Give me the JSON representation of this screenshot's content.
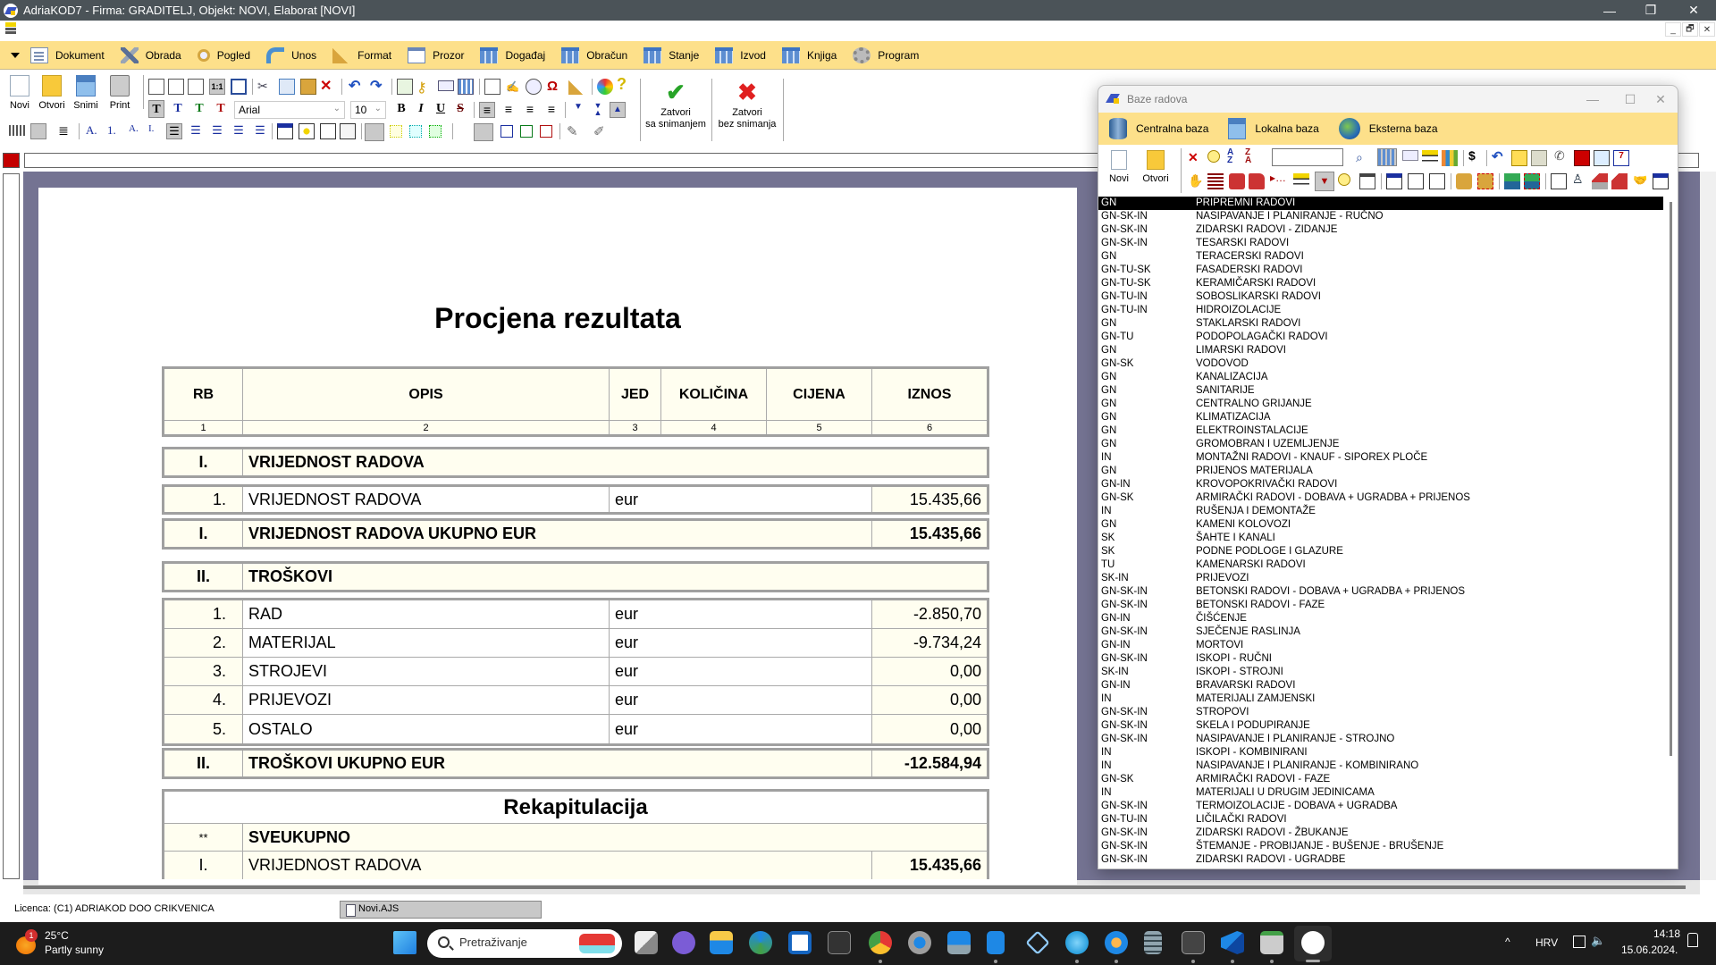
{
  "window": {
    "title": "AdriaKOD7 - Firma: GRADITELJ,   Objekt: NOVI,  Elaborat [NOVI]",
    "minimize": "—",
    "restore": "❐",
    "close": "✕",
    "mdi_minimize": "_",
    "mdi_restore": "🗗",
    "mdi_close": "✕"
  },
  "menubar": {
    "items": [
      {
        "label": "Dokument",
        "icon": "document-icon"
      },
      {
        "label": "Obrada",
        "icon": "tools-icon"
      },
      {
        "label": "Pogled",
        "icon": "magnifier-icon"
      },
      {
        "label": "Unos",
        "icon": "input-icon"
      },
      {
        "label": "Format",
        "icon": "brush-icon"
      },
      {
        "label": "Prozor",
        "icon": "window-icon"
      },
      {
        "label": "Događaj",
        "icon": "grid-icon"
      },
      {
        "label": "Obračun",
        "icon": "grid-icon"
      },
      {
        "label": "Stanje",
        "icon": "grid-icon"
      },
      {
        "label": "Izvod",
        "icon": "grid-icon"
      },
      {
        "label": "Knjiga",
        "icon": "grid-icon"
      },
      {
        "label": "Program",
        "icon": "gear-icon"
      }
    ]
  },
  "toolbar": {
    "new_label": "Novi",
    "open_label": "Otvori",
    "save_label": "Snimi",
    "print_label": "Print",
    "font_name": "Arial",
    "font_size": "10",
    "text_style_glyph": "T",
    "bold_glyph": "B",
    "italic_glyph": "I",
    "underline_glyph": "U",
    "strike_glyph": "S",
    "zoom_11": "1:1",
    "close_save_line1": "Zatvori",
    "close_save_line2": "sa snimanjem",
    "close_nosave_line1": "Zatvori",
    "close_nosave_line2": "bez snimanja",
    "check_glyph": "✔",
    "x_glyph": "✖"
  },
  "document": {
    "title": "Procjena rezultata",
    "header": {
      "cols": [
        "RB",
        "OPIS",
        "JED",
        "KOLIČINA",
        "CIJENA",
        "IZNOS"
      ],
      "nums": [
        "1",
        "2",
        "3",
        "4",
        "5",
        "6"
      ]
    },
    "section1": {
      "rb": "I.",
      "title": "VRIJEDNOST RADOVA",
      "items": [
        {
          "rb": "1.",
          "opis": "VRIJEDNOST RADOVA",
          "jed": "eur",
          "iznos": "15.435,66"
        }
      ],
      "total_rb": "I.",
      "total_label": "VRIJEDNOST RADOVA UKUPNO EUR",
      "total_value": "15.435,66"
    },
    "section2": {
      "rb": "II.",
      "title": "TROŠKOVI",
      "items": [
        {
          "rb": "1.",
          "opis": "RAD",
          "jed": "eur",
          "iznos": "-2.850,70"
        },
        {
          "rb": "2.",
          "opis": "MATERIJAL",
          "jed": "eur",
          "iznos": "-9.734,24"
        },
        {
          "rb": "3.",
          "opis": "STROJEVI",
          "jed": "eur",
          "iznos": "0,00"
        },
        {
          "rb": "4.",
          "opis": "PRIJEVOZI",
          "jed": "eur",
          "iznos": "0,00"
        },
        {
          "rb": "5.",
          "opis": "OSTALO",
          "jed": "eur",
          "iznos": "0,00"
        }
      ],
      "total_rb": "II.",
      "total_label": "TROŠKOVI UKUPNO EUR",
      "total_value": "-12.584,94"
    },
    "recap": {
      "title": "Rekapitulacija",
      "sum_rb": "**",
      "sum_label": "SVEUKUPNO",
      "rows": [
        {
          "rb": "I.",
          "opis": "VRIJEDNOST RADOVA",
          "iznos": "15.435,66"
        }
      ]
    }
  },
  "dialog": {
    "title": "Baze radova",
    "minimize": "—",
    "maximize": "☐",
    "close": "✕",
    "tabs": [
      {
        "label": "Centralna baza",
        "icon": "database-icon"
      },
      {
        "label": "Lokalna baza",
        "icon": "floppy-icon"
      },
      {
        "label": "Eksterna baza",
        "icon": "globe-icon"
      }
    ],
    "new_label": "Novi",
    "open_label": "Otvori",
    "search_value": "",
    "selected_index": 0,
    "rows": [
      {
        "code": "GN",
        "name": "PRIPREMNI RADOVI"
      },
      {
        "code": "GN-SK-IN",
        "name": "NASIPAVANJE I PLANIRANJE - RUČNO"
      },
      {
        "code": "GN-SK-IN",
        "name": "ZIDARSKI RADOVI - ZIDANJE"
      },
      {
        "code": "GN-SK-IN",
        "name": "TESARSKI RADOVI"
      },
      {
        "code": "GN",
        "name": "TERACERSKI RADOVI"
      },
      {
        "code": "GN-TU-SK",
        "name": "FASADERSKI RADOVI"
      },
      {
        "code": "GN-TU-SK",
        "name": "KERAMIČARSKI RADOVI"
      },
      {
        "code": "GN-TU-IN",
        "name": "SOBOSLIKARSKI RADOVI"
      },
      {
        "code": "GN-TU-IN",
        "name": "HIDROIZOLACIJE"
      },
      {
        "code": "GN",
        "name": "STAKLARSKI RADOVI"
      },
      {
        "code": "GN-TU",
        "name": "PODOPOLAGAČKI RADOVI"
      },
      {
        "code": "GN",
        "name": "LIMARSKI RADOVI"
      },
      {
        "code": "GN-SK",
        "name": "VODOVOD"
      },
      {
        "code": "GN",
        "name": "KANALIZACIJA"
      },
      {
        "code": "GN",
        "name": "SANITARIJE"
      },
      {
        "code": "GN",
        "name": "CENTRALNO GRIJANJE"
      },
      {
        "code": "GN",
        "name": "KLIMATIZACIJA"
      },
      {
        "code": "GN",
        "name": "ELEKTROINSTALACIJE"
      },
      {
        "code": "GN",
        "name": "GROMOBRAN I UZEMLJENJE"
      },
      {
        "code": "IN",
        "name": "MONTAŽNI RADOVI - KNAUF - SIPOREX PLOČE"
      },
      {
        "code": "GN",
        "name": "PRIJENOS MATERIJALA"
      },
      {
        "code": "GN-IN",
        "name": "KROVOPOKRIVAČKI RADOVI"
      },
      {
        "code": "GN-SK",
        "name": "ARMIRAČKI RADOVI - DOBAVA + UGRADBA + PRIJENOS"
      },
      {
        "code": "IN",
        "name": "RUŠENJA I DEMONTAŽE"
      },
      {
        "code": "GN",
        "name": "KAMENI KOLOVOZI"
      },
      {
        "code": "SK",
        "name": "ŠAHTE I KANALI"
      },
      {
        "code": "SK",
        "name": "PODNE PODLOGE I GLAZURE"
      },
      {
        "code": "TU",
        "name": "KAMENARSKI RADOVI"
      },
      {
        "code": "SK-IN",
        "name": "PRIJEVOZI"
      },
      {
        "code": "GN-SK-IN",
        "name": "BETONSKI RADOVI - DOBAVA + UGRADBA + PRIJENOS"
      },
      {
        "code": "GN-SK-IN",
        "name": "BETONSKI RADOVI - FAZE"
      },
      {
        "code": "GN-IN",
        "name": "ČIŠĆENJE"
      },
      {
        "code": "GN-SK-IN",
        "name": "SJEČENJE RASLINJA"
      },
      {
        "code": "GN-IN",
        "name": "MORTOVI"
      },
      {
        "code": "GN-SK-IN",
        "name": "ISKOPI - RUČNI"
      },
      {
        "code": "SK-IN",
        "name": "ISKOPI - STROJNI"
      },
      {
        "code": "GN-IN",
        "name": "BRAVARSKI RADOVI"
      },
      {
        "code": "IN",
        "name": "MATERIJALI ZAMJENSKI"
      },
      {
        "code": "GN-SK-IN",
        "name": "STROPOVI"
      },
      {
        "code": "GN-SK-IN",
        "name": "SKELA I PODUPIRANJE"
      },
      {
        "code": "GN-SK-IN",
        "name": "NASIPAVANJE I PLANIRANJE - STROJNO"
      },
      {
        "code": "IN",
        "name": "ISKOPI - KOMBINIRANI"
      },
      {
        "code": "IN",
        "name": "NASIPAVANJE I PLANIRANJE - KOMBINIRANO"
      },
      {
        "code": "GN-SK",
        "name": "ARMIRAČKI RADOVI - FAZE"
      },
      {
        "code": "IN",
        "name": "MATERIJALI U DRUGIM JEDINICAMA"
      },
      {
        "code": "GN-SK-IN",
        "name": "TERMOIZOLACIJE - DOBAVA + UGRADBA"
      },
      {
        "code": "GN-TU-IN",
        "name": "LIČILAČKI RADOVI"
      },
      {
        "code": "GN-SK-IN",
        "name": "ZIDARSKI RADOVI - ŽBUKANJE"
      },
      {
        "code": "GN-SK-IN",
        "name": "ŠTEMANJE - PROBIJANJE - BUŠENJE - BRUŠENJE"
      },
      {
        "code": "GN-SK-IN",
        "name": "ZIDARSKI RADOVI - UGRADBE"
      }
    ]
  },
  "statusbar": {
    "license": "Licenca:  (C1) ADRIAKOD DOO CRIKVENICA",
    "doc_tab": "Novi.AJS"
  },
  "taskbar": {
    "weather_temp": "25°C",
    "weather_desc": "Partly sunny",
    "weather_badge": "1",
    "search_placeholder": "Pretraživanje",
    "language": "HRV",
    "time": "14:18",
    "date": "15.06.2024.",
    "chevron": "^"
  },
  "colors": {
    "menubar_bg": "#fde08a",
    "titlebar_bg": "#4b5358",
    "doc_bg": "#747392",
    "table_bg": "#fffef0",
    "selected_row_bg": "#000000"
  }
}
